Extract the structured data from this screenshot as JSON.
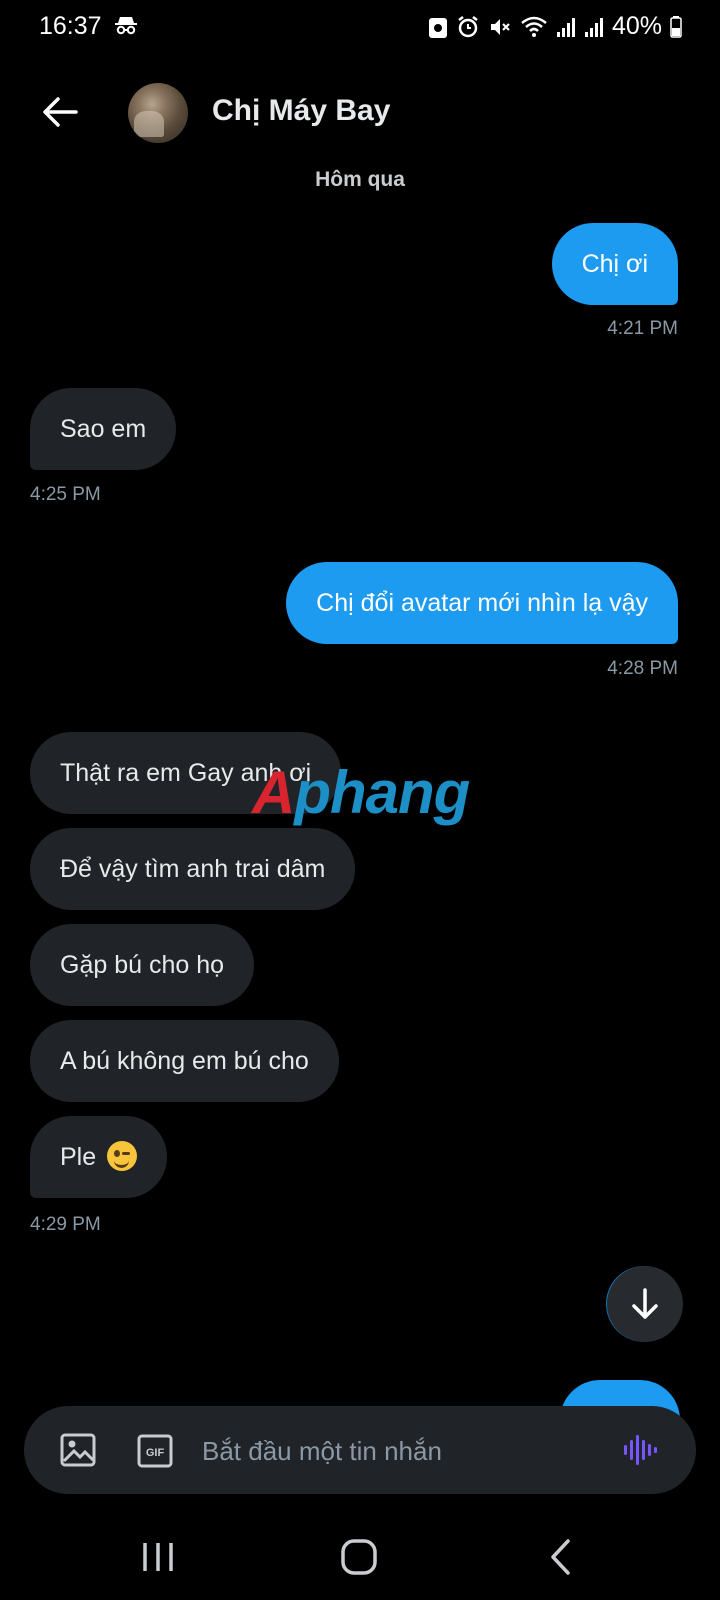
{
  "status_bar": {
    "time": "16:37",
    "battery": "40%"
  },
  "header": {
    "contact_name": "Chị Máy Bay"
  },
  "day_label": "Hôm qua",
  "messages": [
    {
      "dir": "out",
      "text": "Chị ơi",
      "time": "4:21 PM"
    },
    {
      "dir": "in",
      "text": "Sao em",
      "time": "4:25 PM"
    },
    {
      "dir": "out",
      "text": "Chị đổi avatar mới nhìn lạ vậy",
      "time": "4:28 PM"
    },
    {
      "dir": "in",
      "text": "Thật ra em Gay anh ơi"
    },
    {
      "dir": "in",
      "text": "Để vậy tìm anh trai dâm"
    },
    {
      "dir": "in",
      "text": "Gặp bú cho họ"
    },
    {
      "dir": "in",
      "text": "A bú không em bú cho"
    },
    {
      "dir": "in",
      "text": "Ple",
      "emoji": "winking-face",
      "time": "4:29 PM"
    }
  ],
  "watermark": {
    "part1": "A",
    "part2": "phang"
  },
  "composer": {
    "placeholder": "Bắt đầu một tin nhắn"
  },
  "colors": {
    "outgoing": "#1d9bf0",
    "incoming": "#202327",
    "background": "#000000"
  }
}
